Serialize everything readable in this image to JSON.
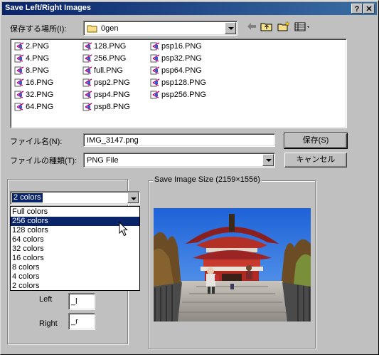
{
  "window": {
    "title": "Save Left/Right Images",
    "help_label": "?",
    "close_label": "✕"
  },
  "location": {
    "label": "保存する場所(I):",
    "value": "0gen",
    "folder_icon": "folder-icon"
  },
  "toolbar": {
    "icons": [
      "back-arrow-icon",
      "up-folder-icon",
      "new-folder-icon",
      "view-menu-icon"
    ]
  },
  "files": {
    "col1": [
      "2.PNG",
      "4.PNG",
      "8.PNG",
      "16.PNG",
      "32.PNG",
      "64.PNG"
    ],
    "col2": [
      "128.PNG",
      "256.PNG",
      "full.PNG",
      "psp2.PNG",
      "psp4.PNG",
      "psp8.PNG"
    ],
    "col3": [
      "psp16.PNG",
      "psp32.PNG",
      "psp64.PNG",
      "psp128.PNG",
      "psp256.PNG"
    ]
  },
  "filename": {
    "label": "ファイル名(N):",
    "value": "IMG_3147.png"
  },
  "filetype": {
    "label": "ファイルの種類(T):",
    "value": "PNG File"
  },
  "buttons": {
    "save": "保存(S)",
    "cancel": "キャンセル"
  },
  "colors": {
    "selected": "2 colors",
    "options": [
      "Full colors",
      "256 colors",
      "128 colors",
      "64 colors",
      "32 colors",
      "16 colors",
      "8 colors",
      "4 colors",
      "2 colors"
    ],
    "highlighted_index": 1
  },
  "side_fields": {
    "left_label": "Left",
    "left_value": "_l",
    "right_label": "Right",
    "right_value": "_r"
  },
  "preview": {
    "group_label": "Save Image Size (2159×1556)"
  },
  "theme": {
    "titlebar_start": "#0a246a",
    "titlebar_end": "#3a6ea5",
    "face": "#c0c0c0",
    "selection": "#0a246a"
  }
}
